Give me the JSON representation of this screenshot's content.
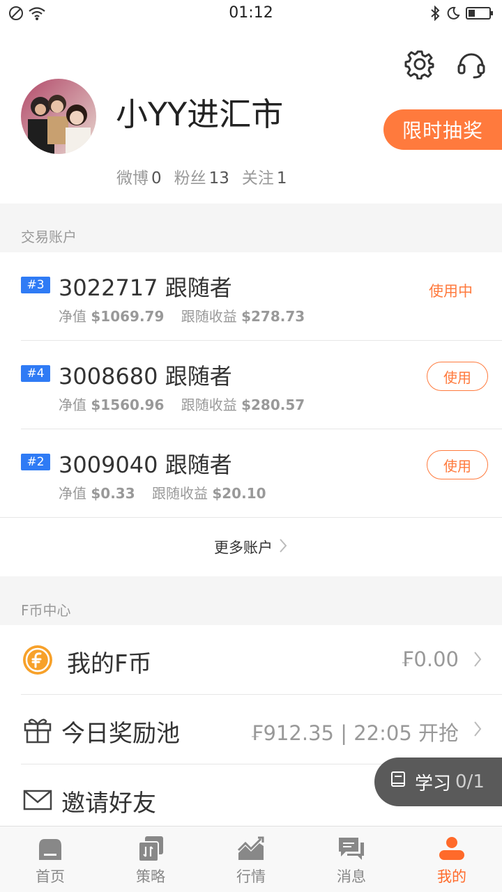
{
  "status_bar": {
    "time": "01:12"
  },
  "profile": {
    "username": "小YY进汇市",
    "lottery_label": "限时抽奖",
    "stats": [
      {
        "label": "微博",
        "value": "0"
      },
      {
        "label": "粉丝",
        "value": "13"
      },
      {
        "label": "关注",
        "value": "1"
      }
    ]
  },
  "accounts_section": {
    "title": "交易账户",
    "accounts": [
      {
        "badge": "#3",
        "title": "3022717 跟随者",
        "net_label": "净值",
        "net_value": "$1069.79",
        "gain_label": "跟随收益",
        "gain_value": "$278.73",
        "status": "使用中"
      },
      {
        "badge": "#4",
        "title": "3008680 跟随者",
        "net_label": "净值",
        "net_value": "$1560.96",
        "gain_label": "跟随收益",
        "gain_value": "$280.57",
        "action": "使用"
      },
      {
        "badge": "#2",
        "title": "3009040 跟随者",
        "net_label": "净值",
        "net_value": "$0.33",
        "gain_label": "跟随收益",
        "gain_value": "$20.10",
        "action": "使用"
      }
    ],
    "more_label": "更多账户"
  },
  "fcoin_section": {
    "title": "F币中心",
    "rows": [
      {
        "label": "我的F币",
        "value": "₣0.00"
      },
      {
        "label": "今日奖励池",
        "value": "₣912.35 | 22:05 开抢"
      },
      {
        "label": "邀请好友",
        "value": ""
      }
    ]
  },
  "study_float": {
    "label": "学习",
    "count": "0/1"
  },
  "tabbar": {
    "tabs": [
      {
        "label": "首页"
      },
      {
        "label": "策略"
      },
      {
        "label": "行情"
      },
      {
        "label": "消息"
      },
      {
        "label": "我的"
      }
    ]
  },
  "colors": {
    "accent": "#ff7a3d",
    "badge": "#2f7bf5",
    "active_tab": "#ff6a2a"
  }
}
